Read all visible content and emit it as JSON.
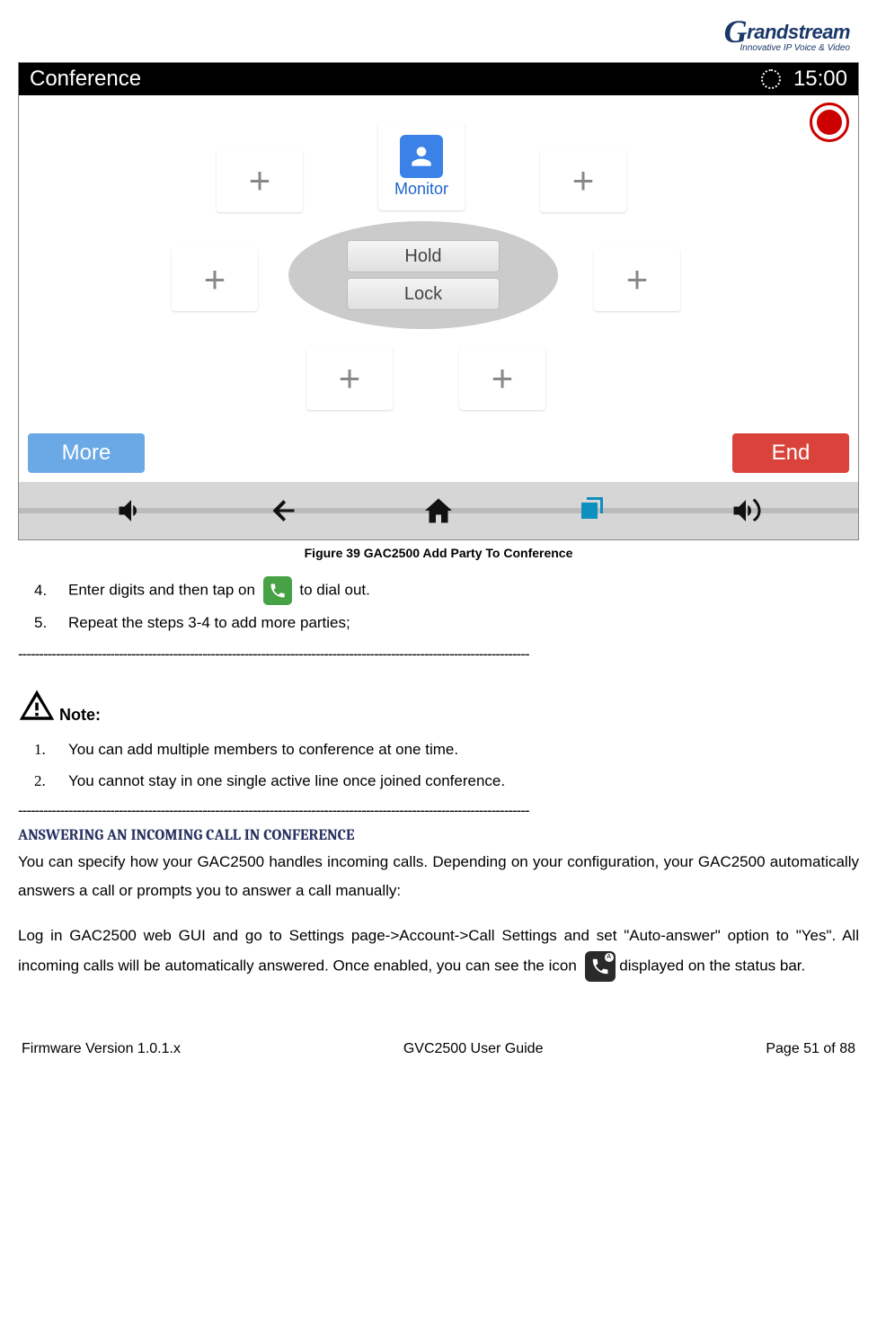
{
  "header": {
    "brand_main": "randstream",
    "brand_g": "G",
    "brand_sub": "Innovative IP Voice & Video"
  },
  "screenshot": {
    "status_title": "Conference",
    "status_time": "15:00",
    "monitor_label": "Monitor",
    "btn_hold": "Hold",
    "btn_lock": "Lock",
    "btn_more": "More",
    "btn_end": "End"
  },
  "figure_caption": "Figure 39 GAC2500 Add Party To Conference",
  "steps": {
    "s4_num": "4.",
    "s4_before": "Enter digits and then tap on",
    "s4_after": " to dial out.",
    "s5_num": "5.",
    "s5_text": "Repeat the steps 3-4 to add more parties;"
  },
  "note_label": "Note:",
  "notes": {
    "n1_num": "1.",
    "n1_text": "You can add multiple members to conference at one time.",
    "n2_num": "2.",
    "n2_text": "You cannot stay in one single active line once joined conference."
  },
  "section_heading": "ANSWERING AN INCOMING CALL IN CONFERENCE",
  "para1": "You can specify how your GAC2500 handles incoming calls. Depending on your configuration, your GAC2500 automatically answers a call or prompts you to answer a call manually:",
  "para2_before": "Log in GAC2500 web GUI and go to Settings page->Account->Call Settings and set \"Auto-answer\" option to \"Yes\". All incoming calls will be automatically answered. Once enabled, you can see the icon",
  "para2_after": " displayed on the status bar.",
  "dashes": "--------------------------------------------------------------------------------------------------------------------------",
  "footer": {
    "left": "Firmware Version 1.0.1.x",
    "center": "GVC2500 User Guide",
    "right": "Page 51 of 88"
  }
}
